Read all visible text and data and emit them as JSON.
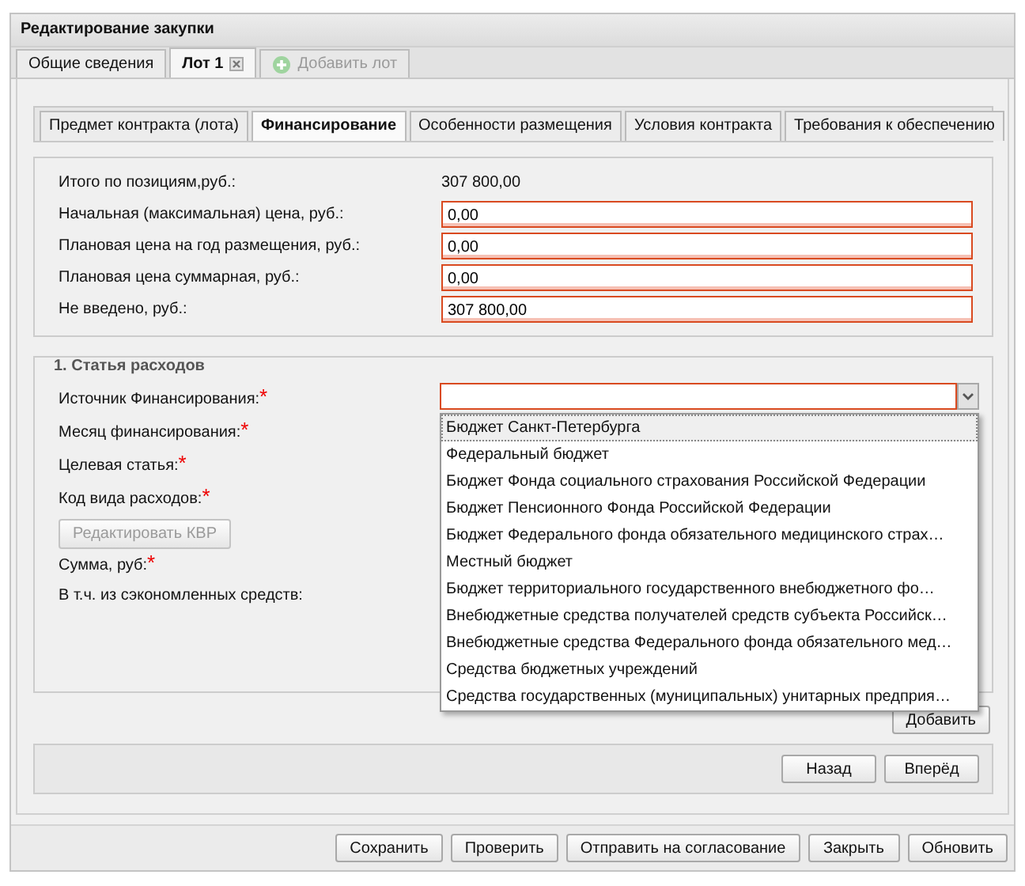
{
  "window": {
    "title": "Редактирование закупки"
  },
  "tabs": [
    {
      "label": "Общие сведения",
      "selected": false,
      "closable": false
    },
    {
      "label": "Лот 1",
      "selected": true,
      "closable": true
    }
  ],
  "add_tab": {
    "label": "Добавить лот",
    "disabled": true
  },
  "subtabs": [
    {
      "label": "Предмет контракта (лота)",
      "selected": false
    },
    {
      "label": "Финансирование",
      "selected": true
    },
    {
      "label": "Особенности размещения",
      "selected": false
    },
    {
      "label": "Условия контракта",
      "selected": false
    },
    {
      "label": "Требования к обеспечению",
      "selected": false
    }
  ],
  "totals": {
    "label": "Итого по позициям,руб.:",
    "value": "307 800,00"
  },
  "price_fields": [
    {
      "label": "Начальная (максимальная) цена, руб.:",
      "value": "0,00",
      "invalid": true
    },
    {
      "label": "Плановая цена на год размещения, руб.:",
      "value": "0,00",
      "invalid": true
    },
    {
      "label": "Плановая цена суммарная, руб.:",
      "value": "0,00",
      "invalid": true
    },
    {
      "label": "Не введено, руб.:",
      "value": "307 800,00",
      "invalid": true
    }
  ],
  "expense_section": {
    "legend": "1. Статья расходов",
    "fields": [
      {
        "kind": "combo",
        "label": "Источник Финансирования:",
        "mark": "*",
        "invalid": true,
        "expanded": true
      },
      {
        "kind": "label",
        "label": "Месяц финансирования:",
        "mark": "*"
      },
      {
        "kind": "label",
        "label": "Целевая статья:",
        "mark": "*"
      },
      {
        "kind": "label",
        "label": "Код вида расходов:",
        "mark": "*"
      },
      {
        "kind": "button",
        "label": "Редактировать КВР",
        "disabled": true
      },
      {
        "kind": "label",
        "label": "Сумма, руб:",
        "mark": "*"
      },
      {
        "kind": "label",
        "label": "В т.ч. из сэкономленных средств:"
      }
    ],
    "options": [
      {
        "label": "Бюджет Санкт-Петербурга",
        "selected": true
      },
      {
        "label": "Федеральный бюджет",
        "selected": false
      },
      {
        "label": "Бюджет Фонда социального страхования Российской Федерации",
        "selected": false
      },
      {
        "label": "Бюджет Пенсионного Фонда Российской Федерации",
        "selected": false
      },
      {
        "label": "Бюджет Федерального фонда обязательного медицинского страх…",
        "selected": false
      },
      {
        "label": "Местный бюджет",
        "selected": false
      },
      {
        "label": "Бюджет территориального государственного внебюджетного фо…",
        "selected": false
      },
      {
        "label": "Внебюджетные средства получателей средств субъекта Российск…",
        "selected": false
      },
      {
        "label": "Внебюджетные средства Федерального фонда обязательного мед…",
        "selected": false
      },
      {
        "label": "Средства бюджетных учреждений",
        "selected": false
      },
      {
        "label": "Средства государственных (муниципальных) унитарных предприя…",
        "selected": false
      }
    ],
    "add_button": "Добавить"
  },
  "nav_buttons": [
    "Назад",
    "Вперёд"
  ],
  "footer_buttons": [
    "Сохранить",
    "Проверить",
    "Отправить на согласование",
    "Закрыть",
    "Обновить"
  ]
}
